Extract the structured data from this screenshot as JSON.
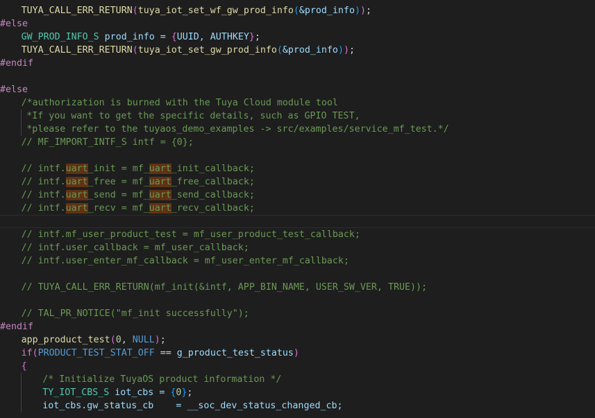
{
  "editor": {
    "lines": [
      {
        "indent": 4,
        "tokens": [
          {
            "t": "TUYA_CALL_ERR_RETURN",
            "c": "fn"
          },
          {
            "t": "(",
            "c": "br"
          },
          {
            "t": "tuya_iot_set_wf_gw_prod_info",
            "c": "fn"
          },
          {
            "t": "(",
            "c": "br2"
          },
          {
            "t": "&prod_info",
            "c": "vr"
          },
          {
            "t": ")",
            "c": "br2"
          },
          {
            "t": ")",
            "c": "br"
          },
          {
            "t": ";",
            "c": "pu"
          }
        ]
      },
      {
        "indent": 0,
        "tokens": [
          {
            "t": "#else",
            "c": "kw"
          }
        ]
      },
      {
        "indent": 4,
        "tokens": [
          {
            "t": "GW_PROD_INFO_S",
            "c": "ty"
          },
          {
            "t": " prod_info = ",
            "c": "vr"
          },
          {
            "t": "{",
            "c": "br"
          },
          {
            "t": "UUID, AUTHKEY",
            "c": "vr"
          },
          {
            "t": "}",
            "c": "br"
          },
          {
            "t": ";",
            "c": "pu"
          }
        ]
      },
      {
        "indent": 4,
        "tokens": [
          {
            "t": "TUYA_CALL_ERR_RETURN",
            "c": "fn"
          },
          {
            "t": "(",
            "c": "br"
          },
          {
            "t": "tuya_iot_set_gw_prod_info",
            "c": "fn"
          },
          {
            "t": "(",
            "c": "br2"
          },
          {
            "t": "&prod_info",
            "c": "vr"
          },
          {
            "t": ")",
            "c": "br2"
          },
          {
            "t": ")",
            "c": "br"
          },
          {
            "t": ";",
            "c": "pu"
          }
        ]
      },
      {
        "indent": 0,
        "tokens": [
          {
            "t": "#endif",
            "c": "kw"
          }
        ]
      },
      {
        "indent": 0,
        "tokens": []
      },
      {
        "indent": 0,
        "tokens": [
          {
            "t": "#else",
            "c": "kw"
          }
        ]
      },
      {
        "indent": 4,
        "tokens": [
          {
            "t": "/*authorization is burned with the Tuya Cloud module tool",
            "c": "cm"
          }
        ]
      },
      {
        "indent": 5,
        "tokens": [
          {
            "t": "*If you want to get the specific details, such as GPIO TEST,",
            "c": "cm"
          }
        ]
      },
      {
        "indent": 5,
        "tokens": [
          {
            "t": "*please refer to the tuyaos_demo_examples -> src/examples/service_mf_test.*/",
            "c": "cm"
          }
        ]
      },
      {
        "indent": 4,
        "tokens": [
          {
            "t": "// MF_IMPORT_INTF_S intf = {0};",
            "c": "cm"
          }
        ]
      },
      {
        "indent": 0,
        "tokens": []
      },
      {
        "indent": 4,
        "tokens": [
          {
            "t": "// intf.",
            "c": "cm"
          },
          {
            "t": "uart",
            "c": "cm hl"
          },
          {
            "t": "_init = mf_",
            "c": "cm"
          },
          {
            "t": "uart",
            "c": "cm hl"
          },
          {
            "t": "_init_callback;",
            "c": "cm"
          }
        ]
      },
      {
        "indent": 4,
        "tokens": [
          {
            "t": "// intf.",
            "c": "cm"
          },
          {
            "t": "uart",
            "c": "cm hl"
          },
          {
            "t": "_free = mf_",
            "c": "cm"
          },
          {
            "t": "uart",
            "c": "cm hl"
          },
          {
            "t": "_free_callback;",
            "c": "cm"
          }
        ]
      },
      {
        "indent": 4,
        "tokens": [
          {
            "t": "// intf.",
            "c": "cm"
          },
          {
            "t": "uart",
            "c": "cm hl"
          },
          {
            "t": "_send = mf_",
            "c": "cm"
          },
          {
            "t": "uart",
            "c": "cm hl"
          },
          {
            "t": "_send_callback;",
            "c": "cm"
          }
        ]
      },
      {
        "indent": 4,
        "tokens": [
          {
            "t": "// intf.",
            "c": "cm"
          },
          {
            "t": "uart",
            "c": "cm hl"
          },
          {
            "t": "_recv = mf_",
            "c": "cm"
          },
          {
            "t": "uart",
            "c": "cm hl"
          },
          {
            "t": "_recv_callback;",
            "c": "cm"
          }
        ]
      },
      {
        "indent": 0,
        "tokens": [],
        "current": true
      },
      {
        "indent": 4,
        "tokens": [
          {
            "t": "// intf.mf_user_product_test = mf_user_product_test_callback;",
            "c": "cm"
          }
        ]
      },
      {
        "indent": 4,
        "tokens": [
          {
            "t": "// intf.user_callback = mf_user_callback;",
            "c": "cm"
          }
        ]
      },
      {
        "indent": 4,
        "tokens": [
          {
            "t": "// intf.user_enter_mf_callback = mf_user_enter_mf_callback;",
            "c": "cm"
          }
        ]
      },
      {
        "indent": 0,
        "tokens": []
      },
      {
        "indent": 4,
        "tokens": [
          {
            "t": "// TUYA_CALL_ERR_RETURN(mf_init(&intf, APP_BIN_NAME, USER_SW_VER, TRUE));",
            "c": "cm"
          }
        ]
      },
      {
        "indent": 0,
        "tokens": []
      },
      {
        "indent": 4,
        "tokens": [
          {
            "t": "// TAL_PR_NOTICE(\"mf_init successfully\");",
            "c": "cm"
          }
        ]
      },
      {
        "indent": 0,
        "tokens": [
          {
            "t": "#endif",
            "c": "kw"
          }
        ]
      },
      {
        "indent": 4,
        "tokens": [
          {
            "t": "app_product_test",
            "c": "fn"
          },
          {
            "t": "(",
            "c": "br"
          },
          {
            "t": "0",
            "c": "nu"
          },
          {
            "t": ", ",
            "c": "pu"
          },
          {
            "t": "NULL",
            "c": "mc"
          },
          {
            "t": ")",
            "c": "br"
          },
          {
            "t": ";",
            "c": "pu"
          }
        ]
      },
      {
        "indent": 4,
        "tokens": [
          {
            "t": "if",
            "c": "kw"
          },
          {
            "t": "(",
            "c": "br"
          },
          {
            "t": "PRODUCT_TEST_STAT_OFF",
            "c": "mc"
          },
          {
            "t": " == ",
            "c": "pu"
          },
          {
            "t": "g_product_test_status",
            "c": "vr"
          },
          {
            "t": ")",
            "c": "br"
          }
        ]
      },
      {
        "indent": 4,
        "tokens": [
          {
            "t": "{",
            "c": "br"
          }
        ]
      },
      {
        "indent": 8,
        "tokens": [
          {
            "t": "/* Initialize TuyaOS product information */",
            "c": "cm"
          }
        ]
      },
      {
        "indent": 8,
        "tokens": [
          {
            "t": "TY_IOT_CBS_S",
            "c": "ty"
          },
          {
            "t": " iot_cbs = ",
            "c": "vr"
          },
          {
            "t": "{",
            "c": "br2"
          },
          {
            "t": "0",
            "c": "nu"
          },
          {
            "t": "}",
            "c": "br2"
          },
          {
            "t": ";",
            "c": "pu"
          }
        ]
      },
      {
        "indent": 8,
        "tokens": [
          {
            "t": "iot_cbs.gw_status_cb    = __soc_dev_status_changed_cb;",
            "c": "vr"
          }
        ]
      }
    ]
  }
}
